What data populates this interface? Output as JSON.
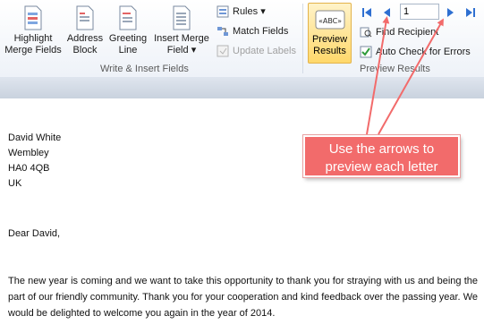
{
  "ribbon": {
    "write_insert": {
      "highlight": {
        "line1": "Highlight",
        "line2": "Merge Fields"
      },
      "address": {
        "line1": "Address",
        "line2": "Block"
      },
      "greeting": {
        "line1": "Greeting",
        "line2": "Line"
      },
      "insert_merge": {
        "line1": "Insert Merge",
        "line2": "Field"
      },
      "rules": "Rules",
      "match_fields": "Match Fields",
      "update_labels": "Update Labels",
      "group_label": "Write & Insert Fields"
    },
    "preview": {
      "preview_button": {
        "line1": "Preview",
        "line2": "Results",
        "icon_text": "«ABC»"
      },
      "record_number": "1",
      "find_recipient": "Find Recipient",
      "auto_check": "Auto Check for Errors",
      "group_label": "Preview Results"
    }
  },
  "document": {
    "address_lines": [
      "David White",
      "Wembley",
      "HA0 4QB",
      "UK"
    ],
    "salutation": "Dear David,",
    "body": "The new year is coming and we want to take this opportunity to thank you for straying with us and being the part of our friendly community. Thank you for your cooperation and kind feedback over the passing year. We would be delighted to welcome you again in the year of 2014."
  },
  "callout": {
    "line1": "Use the arrows to",
    "line2": "preview each letter",
    "color": "#f26b6b"
  },
  "colors": {
    "accent": "#ffd86b",
    "nav_arrow": "#2e6fd1"
  }
}
